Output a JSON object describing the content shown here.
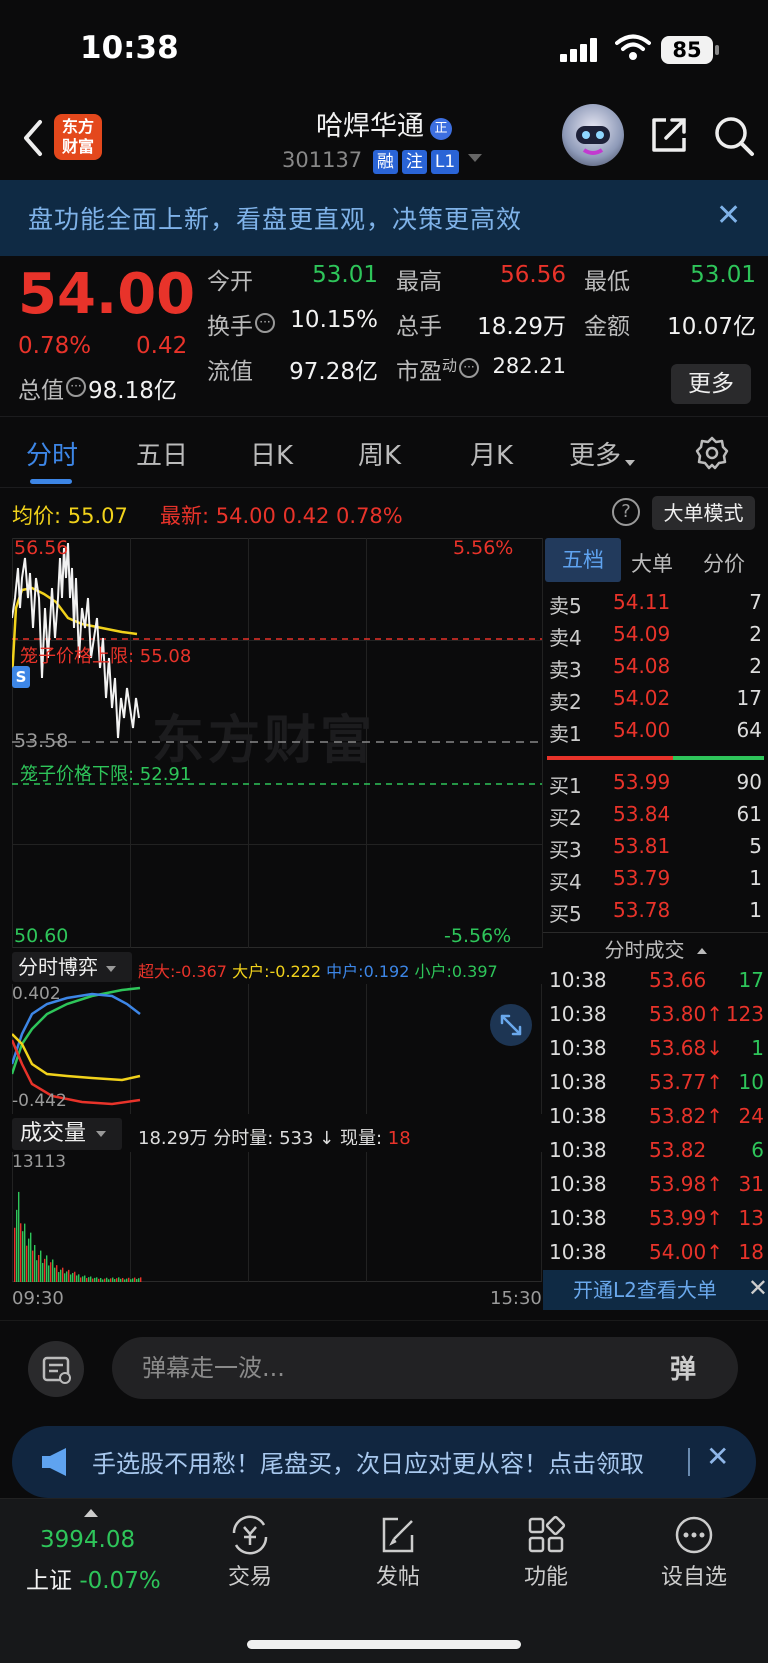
{
  "status_bar": {
    "time": "10:38",
    "battery": "85"
  },
  "nav": {
    "logo_line1": "东方",
    "logo_line2": "财富",
    "stock_name": "哈焊华通",
    "name_badge": "正",
    "stock_code": "301137",
    "tags": [
      "融",
      "注",
      "L1"
    ]
  },
  "banner": {
    "text": "盘功能全面上新，看盘更直观，决策更高效",
    "close": "✕"
  },
  "quote": {
    "price": "54.00",
    "change_pct": "0.78%",
    "change": "0.42",
    "open_label": "今开",
    "open": "53.01",
    "high_label": "最高",
    "high": "56.56",
    "low_label": "最低",
    "low": "53.01",
    "turnover_label": "换手",
    "turnover": "10.15%",
    "volume_label": "总手",
    "volume": "18.29万",
    "amount_label": "金额",
    "amount": "10.07亿",
    "mktcap_label": "总值",
    "mktcap": "98.18亿",
    "float_label": "流值",
    "float": "97.28亿",
    "pe_label": "市盈",
    "pe_sup": "动",
    "pe": "282.21",
    "more_button": "更多"
  },
  "tabs": [
    {
      "label": "分时",
      "active": true
    },
    {
      "label": "五日"
    },
    {
      "label": "日K"
    },
    {
      "label": "周K"
    },
    {
      "label": "月K"
    },
    {
      "label": "更多"
    }
  ],
  "info_row": {
    "avg_label": "均价:",
    "avg": "55.07",
    "latest_label": "最新:",
    "latest": "54.00",
    "latest_chg": "0.42",
    "latest_pct": "0.78%",
    "help": "?",
    "big_order_button": "大单模式"
  },
  "intraday": {
    "y_max": "56.56",
    "y_max_pct": "5.56%",
    "y_min": "50.60",
    "y_min_pct": "-5.56%",
    "prev_close": "53.58",
    "cage_upper": "笼子价格上限: 55.08",
    "cage_lower": "笼子价格下限: 52.91",
    "watermark": "东方财富",
    "s_marker": "S"
  },
  "game": {
    "label": "分时博弈",
    "super_label": "超大:",
    "super": "-0.367",
    "big_label": "大户:",
    "big": "-0.222",
    "mid_label": "中户:",
    "mid": "0.192",
    "small_label": "小户:",
    "small": "0.397",
    "y_top": "0.402",
    "y_bottom": "-0.442"
  },
  "volume_panel": {
    "label": "成交量",
    "total": "18.29万",
    "min_vol_label": "分时量:",
    "min_vol": "533 ↓",
    "cur_label": "现量:",
    "cur": "18",
    "y_max": "13113",
    "x_start": "09:30",
    "x_end": "15:30"
  },
  "right_panel": {
    "tabs": [
      "五档",
      "大单",
      "分价"
    ],
    "asks": [
      {
        "label": "卖5",
        "price": "54.11",
        "vol": "7"
      },
      {
        "label": "卖4",
        "price": "54.09",
        "vol": "2"
      },
      {
        "label": "卖3",
        "price": "54.08",
        "vol": "2"
      },
      {
        "label": "卖2",
        "price": "54.02",
        "vol": "17"
      },
      {
        "label": "卖1",
        "price": "54.00",
        "vol": "64"
      }
    ],
    "bids": [
      {
        "label": "买1",
        "price": "53.99",
        "vol": "90"
      },
      {
        "label": "买2",
        "price": "53.84",
        "vol": "61"
      },
      {
        "label": "买3",
        "price": "53.81",
        "vol": "5"
      },
      {
        "label": "买4",
        "price": "53.79",
        "vol": "1"
      },
      {
        "label": "买5",
        "price": "53.78",
        "vol": "1"
      }
    ],
    "ticks_title": "分时成交",
    "ticks": [
      {
        "time": "10:38",
        "price": "53.66",
        "vol": "17",
        "pc": "red",
        "vc": "green"
      },
      {
        "time": "10:38",
        "price": "53.80↑",
        "vol": "123",
        "pc": "red",
        "vc": "red"
      },
      {
        "time": "10:38",
        "price": "53.68↓",
        "vol": "1",
        "pc": "red",
        "vc": "green"
      },
      {
        "time": "10:38",
        "price": "53.77↑",
        "vol": "10",
        "pc": "red",
        "vc": "green"
      },
      {
        "time": "10:38",
        "price": "53.82↑",
        "vol": "24",
        "pc": "red",
        "vc": "red"
      },
      {
        "time": "10:38",
        "price": "53.82",
        "vol": "6",
        "pc": "red",
        "vc": "green"
      },
      {
        "time": "10:38",
        "price": "53.98↑",
        "vol": "31",
        "pc": "red",
        "vc": "red"
      },
      {
        "time": "10:38",
        "price": "53.99↑",
        "vol": "13",
        "pc": "red",
        "vc": "red"
      },
      {
        "time": "10:38",
        "price": "54.00↑",
        "vol": "18",
        "pc": "red",
        "vc": "red"
      }
    ],
    "l2_link": "开通L2查看大单",
    "l2_close": "✕"
  },
  "danmu": {
    "placeholder": "弹幕走一波...",
    "send": "弹"
  },
  "ad": {
    "text": "手选股不用愁！尾盘买，次日应对更从容！点击领取",
    "close": "✕"
  },
  "bottom_nav": {
    "index_value": "3994.08",
    "index_name": "上证",
    "index_pct": "-0.07%",
    "items": [
      "交易",
      "发帖",
      "功能",
      "设自选"
    ]
  }
}
